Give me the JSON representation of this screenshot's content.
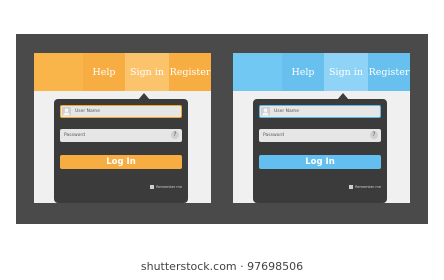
{
  "login_widgets": [
    {
      "theme": "orange",
      "menu": {
        "help": "Help",
        "sign_in": "Sign in",
        "register": "Register"
      },
      "username_placeholder": "User Name",
      "password_placeholder": "Password",
      "help_symbol": "?",
      "button_label": "Log In",
      "remember_label": "Remember me"
    },
    {
      "theme": "blue",
      "menu": {
        "help": "Help",
        "sign_in": "Sign in",
        "register": "Register"
      },
      "username_placeholder": "User Name",
      "password_placeholder": "Password",
      "help_symbol": "?",
      "button_label": "Log In",
      "remember_label": "Remember me"
    }
  ],
  "watermark": "shutterstock.com · 97698506",
  "colors": {
    "frame": "#4a4a4a",
    "panel": "#f0f0f0",
    "card": "#3b3b3b",
    "orange_accent": "#f7ad42",
    "blue_accent": "#63bff0"
  }
}
